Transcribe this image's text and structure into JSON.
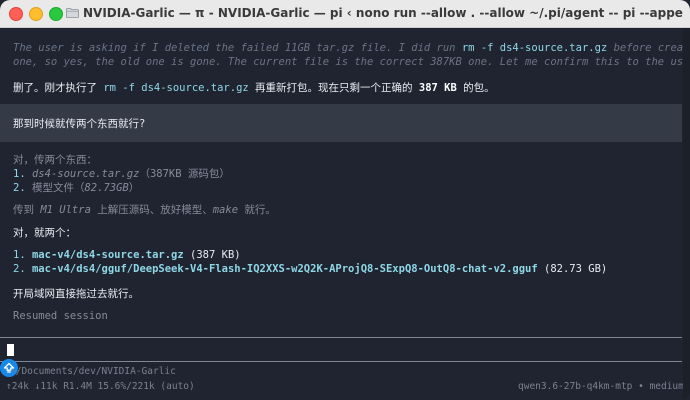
{
  "window": {
    "title": "NVIDIA-Garlic — π - NVIDIA-Garlic — pi ‹ nono run --allow . --allow ~/.pi/agent -- pi --append-system-prompt ~/.pi/agen…",
    "folder_icon": "folder-icon"
  },
  "thinking": {
    "line1_pre": "The user is asking if I deleted the failed 11GB tar.gz file. I did run ",
    "line1_code": "rm -f ds4-source.tar.gz",
    "line1_post": " before creating the new",
    "line2": "one, so yes, the old one is gone. The current file is the correct 387KB one. Let me confirm this to the user."
  },
  "reply1": {
    "pre": "删了。刚才执行了 ",
    "code": "rm -f ds4-source.tar.gz",
    "mid": " 再重新打包。现在只剩一个正确的 ",
    "bold": "387 KB",
    "post": " 的包。"
  },
  "user_message": "那到时候就传两个东西就行?",
  "thinking2": {
    "intro": "对，传两个东西：",
    "item1_num": "1.",
    "item1_it": " ds4-source.tar.gz",
    "item1_rest": "（387KB 源码包）",
    "item2_num": "2.",
    "item2_rest": " 模型文件（",
    "item2_it": "82.73GB",
    "item2_close": "）",
    "line_pre": "传到 ",
    "line_it1": "M1 Ultra",
    "line_mid": " 上解压源码、放好模型、",
    "line_it2": "make",
    "line_post": " 就行。"
  },
  "reply2": {
    "intro": "对，就两个：",
    "item1_num": "1.",
    "item1_path": " mac-v4/ds4-source.tar.gz",
    "item1_size": " (387 KB)",
    "item2_num": "2.",
    "item2_path": " mac-v4/ds4/gguf/DeepSeek-V4-Flash-IQ2XXS-w2Q2K-AProjQ8-SExpQ8-OutQ8-chat-v2.gguf",
    "item2_size": " (82.73 GB)",
    "closing": "开局域网直接拖过去就行。"
  },
  "resumed": "Resumed session",
  "status": {
    "cwd": "~/Documents/dev/NVIDIA-Garlic",
    "stats": "↑24k ↓11k R1.4M 15.6%/221k (auto)",
    "model": "qwen3.6-27b-q4km-mtp • medium"
  },
  "badge_icon": "up-arrow-badge-icon"
}
